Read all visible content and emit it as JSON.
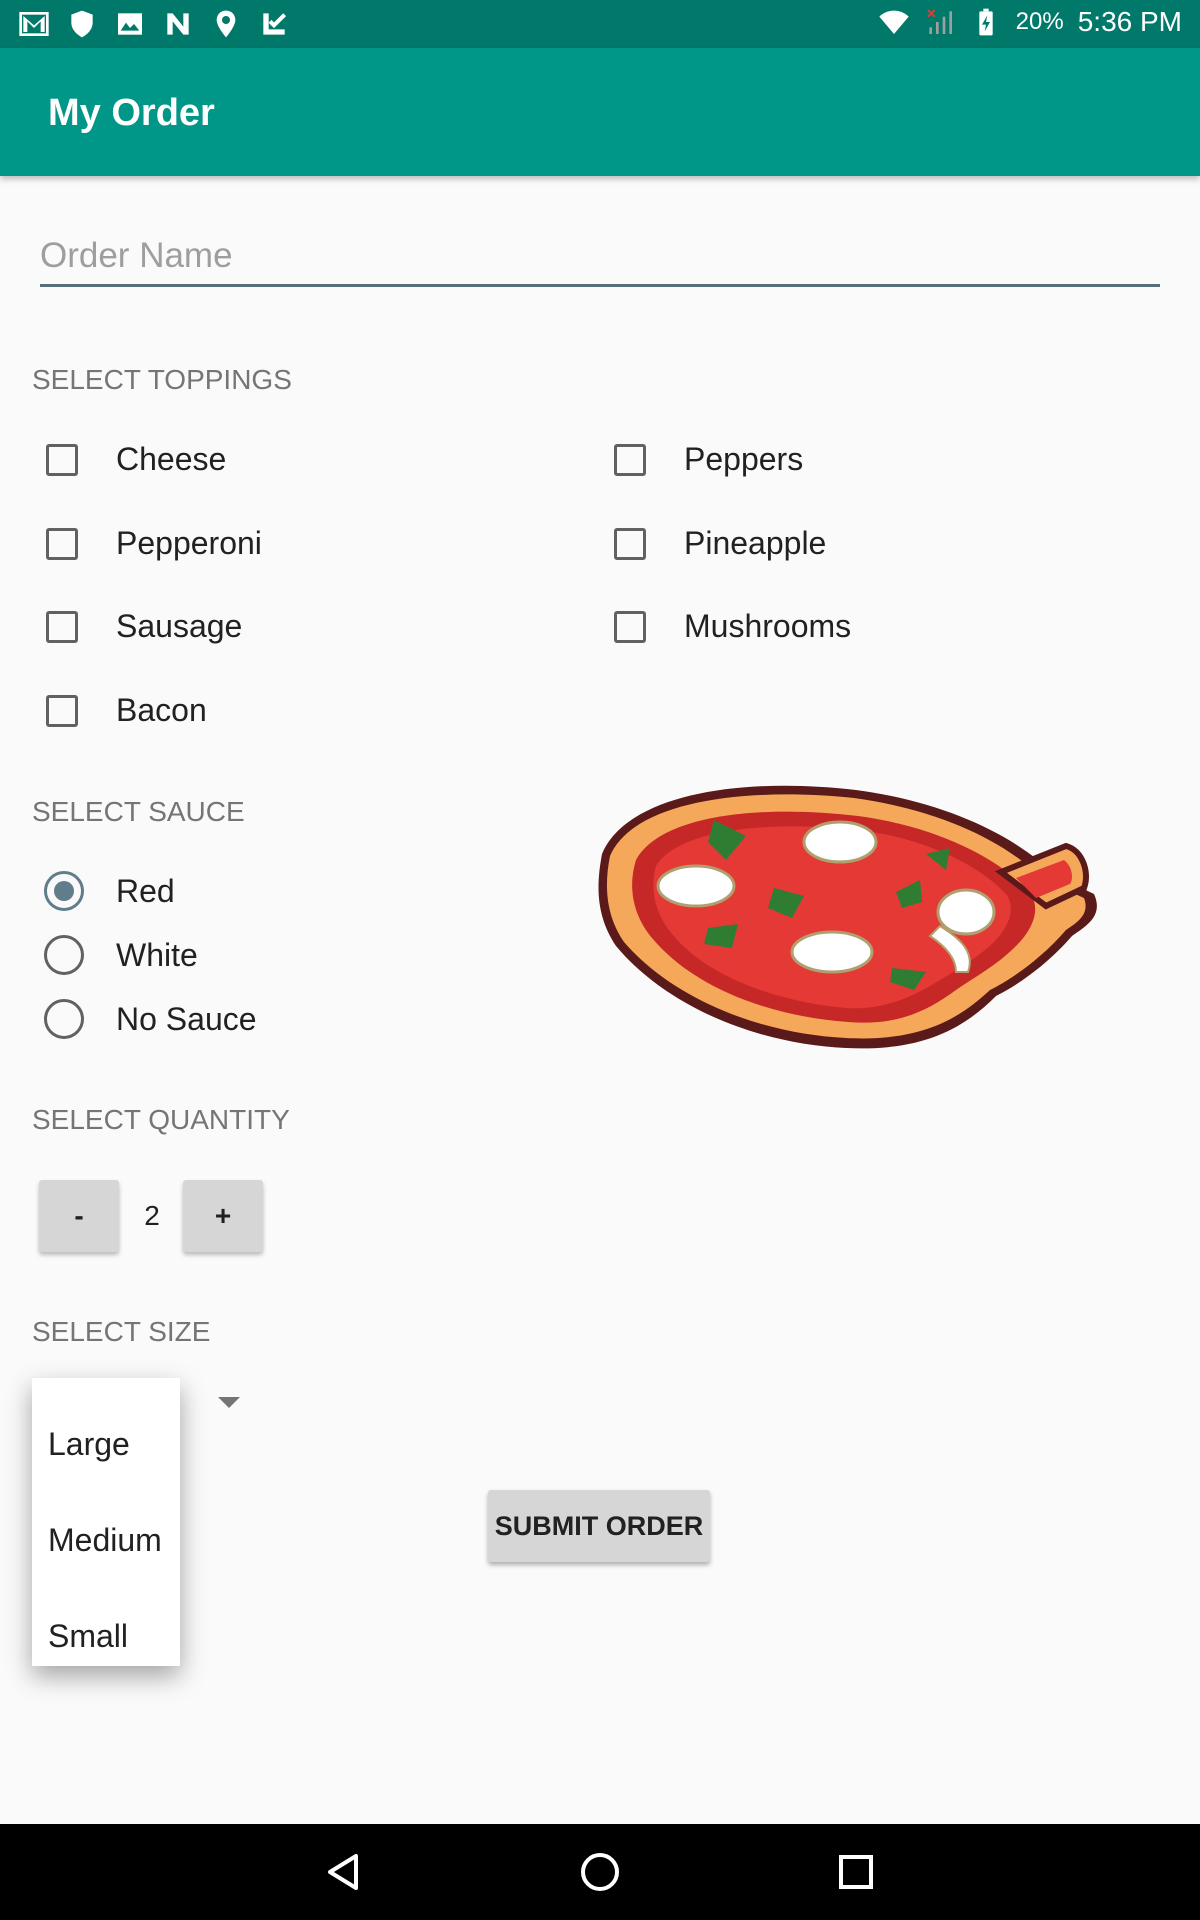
{
  "status_bar": {
    "icons_left": [
      "gmail-icon",
      "shield-icon",
      "image-icon",
      "n-icon",
      "location-icon",
      "check-icon"
    ],
    "battery_percent": "20%",
    "time": "5:36 PM"
  },
  "app_bar": {
    "title": "My Order",
    "color": "#009688",
    "status_color": "#00796b"
  },
  "order_name": {
    "placeholder": "Order Name",
    "value": ""
  },
  "toppings": {
    "label": "SELECT TOPPINGS",
    "left": [
      {
        "label": "Cheese",
        "checked": false
      },
      {
        "label": "Pepperoni",
        "checked": false
      },
      {
        "label": "Sausage",
        "checked": false
      },
      {
        "label": "Bacon",
        "checked": false
      }
    ],
    "right": [
      {
        "label": "Peppers",
        "checked": false
      },
      {
        "label": "Pineapple",
        "checked": false
      },
      {
        "label": "Mushrooms",
        "checked": false
      }
    ]
  },
  "sauce": {
    "label": "SELECT SAUCE",
    "options": [
      {
        "label": "Red",
        "selected": true
      },
      {
        "label": "White",
        "selected": false
      },
      {
        "label": "No Sauce",
        "selected": false
      }
    ]
  },
  "quantity": {
    "label": "SELECT QUANTITY",
    "minus": "-",
    "value": "2",
    "plus": "+"
  },
  "size": {
    "label": "SELECT SIZE",
    "options": [
      "Large",
      "Medium",
      "Small"
    ]
  },
  "submit": {
    "label": "SUBMIT ORDER"
  },
  "nav": {
    "icons": [
      "back-icon",
      "home-icon",
      "recents-icon"
    ]
  }
}
